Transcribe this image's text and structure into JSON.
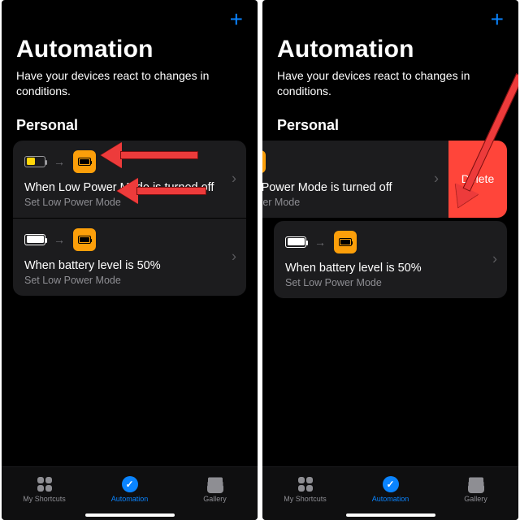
{
  "header": {
    "title": "Automation",
    "subtitle": "Have your devices react to changes in conditions."
  },
  "section": {
    "label": "Personal"
  },
  "cards": [
    {
      "title": "When Low Power Mode is turned off",
      "sub": "Set Low Power Mode"
    },
    {
      "title": "When battery level is 50%",
      "sub": "Set Low Power Mode"
    }
  ],
  "cards_swiped": [
    {
      "title": "ow Power Mode is turned off",
      "sub": "Power Mode"
    }
  ],
  "actions": {
    "delete": "Delete"
  },
  "tabs": {
    "shortcuts": "My Shortcuts",
    "automation": "Automation",
    "gallery": "Gallery"
  }
}
